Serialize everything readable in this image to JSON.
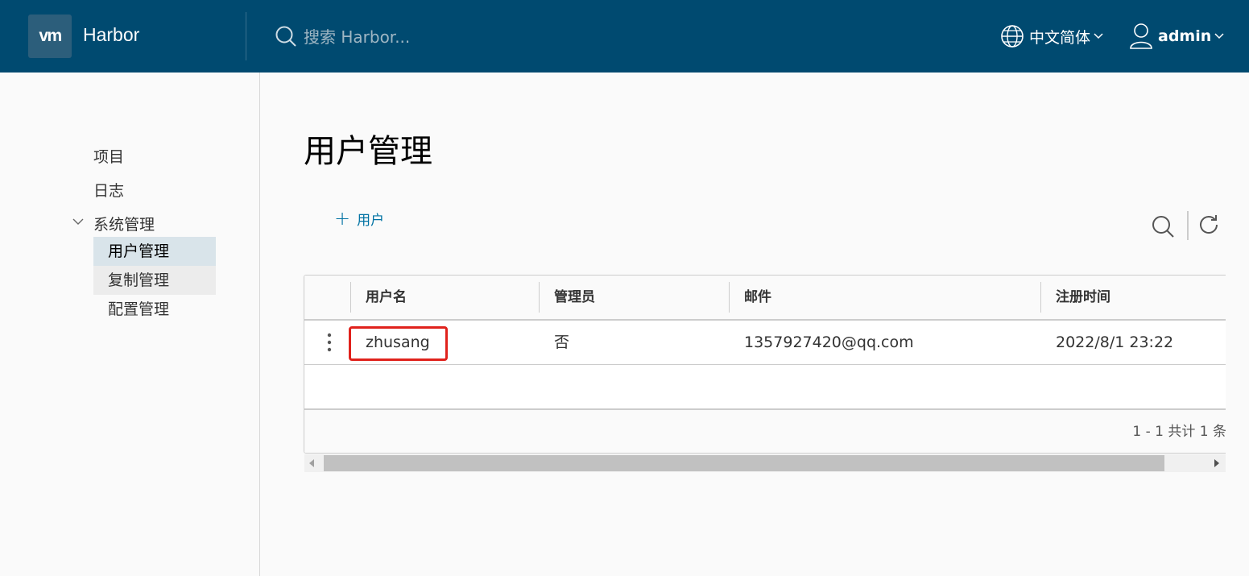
{
  "header": {
    "logo_text": "vm",
    "app_title": "Harbor",
    "search_placeholder": "搜索 Harbor...",
    "language": "中文简体",
    "username": "admin",
    "background_color": "#004a70"
  },
  "sidebar": {
    "items": [
      {
        "label": "项目"
      },
      {
        "label": "日志"
      },
      {
        "label": "系统管理",
        "expanded": true
      }
    ],
    "sub_items": [
      {
        "label": "用户管理",
        "active": true
      },
      {
        "label": "复制管理"
      },
      {
        "label": "配置管理"
      }
    ]
  },
  "main": {
    "title": "用户管理",
    "add_user_label": "用户",
    "accent_color": "#0072a3"
  },
  "table": {
    "columns": [
      "用户名",
      "管理员",
      "邮件",
      "注册时间"
    ],
    "rows": [
      {
        "username": "zhusang",
        "admin": "否",
        "email": "1357927420@qq.com",
        "registered": "2022/8/1 23:22",
        "highlighted": true
      }
    ],
    "pagination": "1 - 1 共计 1 条"
  },
  "icons": [
    "search-icon",
    "globe-icon",
    "chevron-down-icon",
    "user-icon",
    "plus-icon",
    "kebab-menu-icon",
    "refresh-icon"
  ]
}
